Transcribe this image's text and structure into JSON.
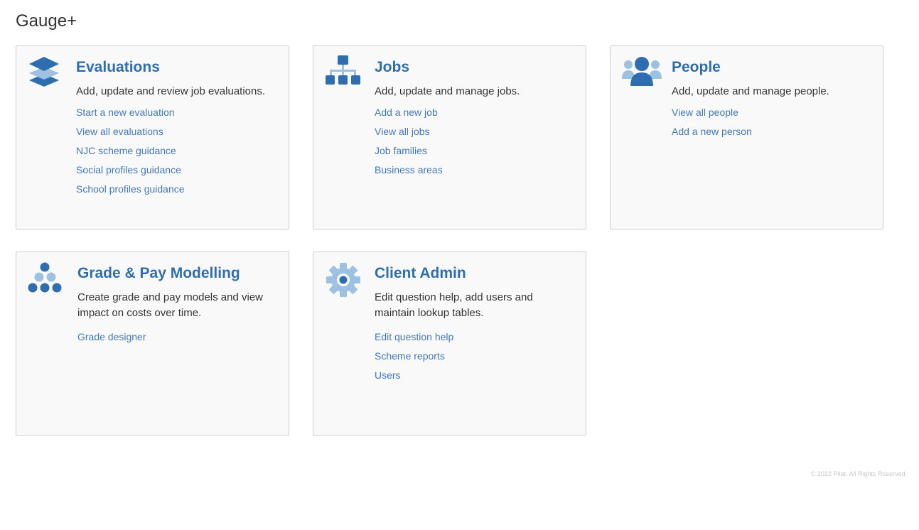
{
  "app": {
    "title": "Gauge+"
  },
  "colors": {
    "accent": "#2e6db0",
    "accent_light": "#9cc1e3",
    "link": "#4478b5",
    "card_bg": "#f9f9f9",
    "card_border": "#cfcfcf"
  },
  "cards": [
    {
      "id": "evaluations",
      "icon": "layers-icon",
      "title": "Evaluations",
      "description": "Add, update and review job evaluations.",
      "links": [
        "Start a new evaluation",
        "View all evaluations",
        "NJC scheme guidance",
        "Social profiles guidance",
        "School profiles guidance"
      ]
    },
    {
      "id": "jobs",
      "icon": "org-chart-icon",
      "title": "Jobs",
      "description": "Add, update and manage jobs.",
      "links": [
        "Add a new job",
        "View all jobs",
        "Job families",
        "Business areas"
      ]
    },
    {
      "id": "people",
      "icon": "people-icon",
      "title": "People",
      "description": "Add, update and manage people.",
      "links": [
        "View all people",
        "Add a new person"
      ]
    },
    {
      "id": "grade-pay",
      "icon": "pyramid-dots-icon",
      "title": "Grade & Pay Modelling",
      "description": "Create grade and pay models and view impact on costs over time.",
      "links": [
        "Grade designer"
      ]
    },
    {
      "id": "client-admin",
      "icon": "gear-icon",
      "title": "Client Admin",
      "description": "Edit question help, add users and maintain lookup tables.",
      "links": [
        "Edit question help",
        "Scheme reports",
        "Users"
      ]
    }
  ],
  "footer": {
    "copyright": "© 2022 Pilat. All Rights Reserved."
  }
}
